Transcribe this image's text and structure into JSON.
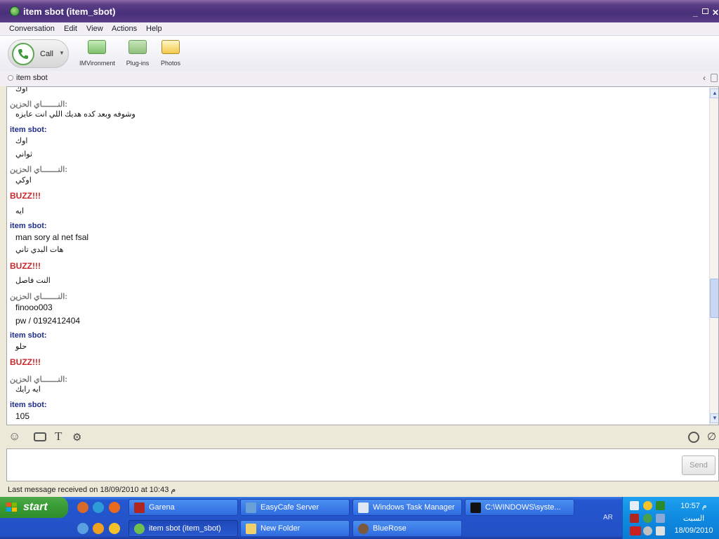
{
  "window": {
    "title": "item sbot (item_sbot)"
  },
  "menu": [
    "Conversation",
    "Edit",
    "View",
    "Actions",
    "Help"
  ],
  "toolbar": {
    "call": "Call",
    "imvironment": "IMVironment",
    "plugins": "Plug-ins",
    "photos": "Photos"
  },
  "contact": {
    "name": "item sbot"
  },
  "messages": [
    {
      "sender": "",
      "text": "اوك"
    },
    {
      "sender": "النـــــــاي الحزين:",
      "text": "وشوفه وبعد كده هديك اللي انت عايزه"
    },
    {
      "sender": "item sbot:",
      "text": "اوك"
    },
    {
      "sender": "",
      "text": "ثواني"
    },
    {
      "sender": "النـــــــاي الحزين:",
      "text": "اوكي"
    },
    {
      "buzz": "BUZZ!!!",
      "text": "ايه"
    },
    {
      "sender": "item sbot:",
      "text": "man sory al net fsal"
    },
    {
      "sender": "",
      "text": "هات البدي تاني"
    },
    {
      "buzz": "BUZZ!!!",
      "text": "النت فاصل"
    },
    {
      "sender": "النـــــــاي الحزين:",
      "text": "finooo003"
    },
    {
      "sender": "",
      "text": "pw / 0192412404"
    },
    {
      "sender": "item sbot:",
      "text": "حلو"
    },
    {
      "buzz": "BUZZ!!!",
      "text": ""
    },
    {
      "sender": "النـــــــاي الحزين:",
      "text": "ايه رايك"
    },
    {
      "sender": "item sbot:",
      "text": "105"
    }
  ],
  "labels": {
    "buzz": "BUZZ!!!",
    "me": "item sbot:",
    "them": "النـــــــاي الحزين:"
  },
  "input": {
    "send": "Send"
  },
  "status": "Last message received on 18/09/2010 at 10:43 م",
  "taskbar": {
    "start": "start",
    "row1": [
      "Garena",
      "EasyCafe Server",
      "Windows Task Manager",
      "C:\\WINDOWS\\syste..."
    ],
    "row2": [
      "item sbot (item_sbot)",
      "New Folder",
      "BlueRose"
    ],
    "lang": "AR",
    "time": "10:57 م",
    "day": "السبت",
    "date": "18/09/2010"
  }
}
